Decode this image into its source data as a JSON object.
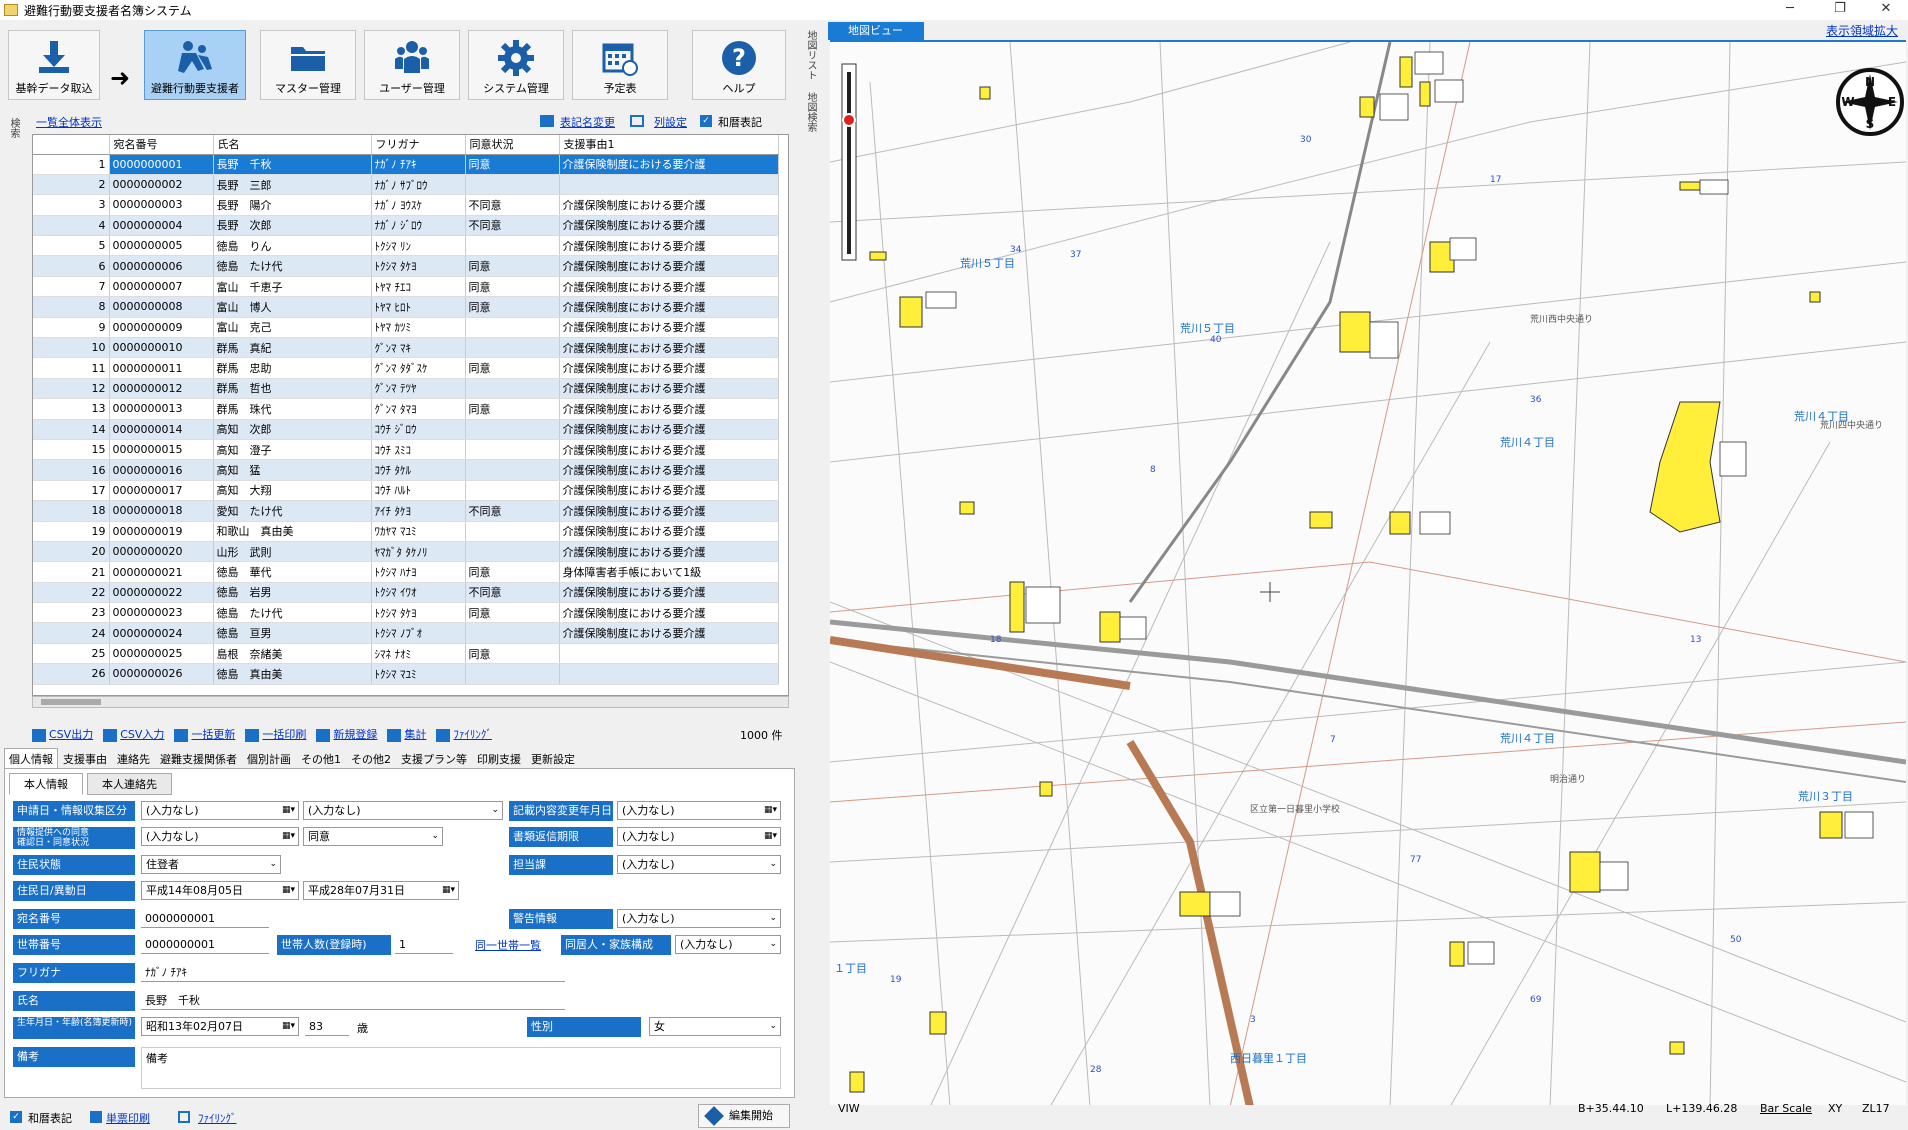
{
  "window": {
    "title": "避難行動要支援者名簿システム",
    "minimize": "─",
    "restore": "❐",
    "close": "✕"
  },
  "toolbar": {
    "buttons": [
      {
        "label": "基幹データ取込",
        "icon": "download-icon"
      },
      {
        "label": "避難行動要支援者",
        "icon": "evacuation-icon",
        "active": true
      },
      {
        "label": "マスター管理",
        "icon": "folder-icon"
      },
      {
        "label": "ユーザー管理",
        "icon": "users-icon"
      },
      {
        "label": "システム管理",
        "icon": "gear-icon"
      },
      {
        "label": "予定表",
        "icon": "calendar-icon"
      },
      {
        "label": "ヘルプ",
        "icon": "help-icon"
      }
    ],
    "arrow": "➜"
  },
  "side_left": "検索",
  "side_right": [
    "地図リスト",
    "地図検索"
  ],
  "grid_header": {
    "show_all": "一覧全体表示",
    "rename": "表記名変更",
    "col_settings": "列設定",
    "wareki": "和暦表記"
  },
  "grid": {
    "columns": [
      "宛名番号",
      "氏名",
      "フリガナ",
      "同意状況",
      "支援事由1"
    ],
    "rows": [
      [
        "1",
        "0000000001",
        "長野　千秋",
        "ﾅｶﾞﾉ ﾁｱｷ",
        "同意",
        "介護保険制度における要介護"
      ],
      [
        "2",
        "0000000002",
        "長野　三郎",
        "ﾅｶﾞﾉ ｻﾌﾞﾛｳ",
        "",
        ""
      ],
      [
        "3",
        "0000000003",
        "長野　陽介",
        "ﾅｶﾞﾉ ﾖｳｽｹ",
        "不同意",
        "介護保険制度における要介護"
      ],
      [
        "4",
        "0000000004",
        "長野　次郎",
        "ﾅｶﾞﾉ ｼﾞﾛｳ",
        "不同意",
        "介護保険制度における要介護"
      ],
      [
        "5",
        "0000000005",
        "徳島　りん",
        "ﾄｸｼﾏ ﾘﾝ",
        "",
        "介護保険制度における要介護"
      ],
      [
        "6",
        "0000000006",
        "徳島　たけ代",
        "ﾄｸｼﾏ ﾀｹﾖ",
        "同意",
        "介護保険制度における要介護"
      ],
      [
        "7",
        "0000000007",
        "富山　千恵子",
        "ﾄﾔﾏ ﾁｴｺ",
        "同意",
        "介護保険制度における要介護"
      ],
      [
        "8",
        "0000000008",
        "富山　博人",
        "ﾄﾔﾏ ﾋﾛﾄ",
        "同意",
        "介護保険制度における要介護"
      ],
      [
        "9",
        "0000000009",
        "富山　克己",
        "ﾄﾔﾏ ｶﾂﾐ",
        "",
        "介護保険制度における要介護"
      ],
      [
        "10",
        "0000000010",
        "群馬　真紀",
        "ｸﾞﾝﾏ ﾏｷ",
        "",
        "介護保険制度における要介護"
      ],
      [
        "11",
        "0000000011",
        "群馬　忠助",
        "ｸﾞﾝﾏ ﾀﾀﾞｽｹ",
        "同意",
        "介護保険制度における要介護"
      ],
      [
        "12",
        "0000000012",
        "群馬　哲也",
        "ｸﾞﾝﾏ ﾃﾂﾔ",
        "",
        "介護保険制度における要介護"
      ],
      [
        "13",
        "0000000013",
        "群馬　珠代",
        "ｸﾞﾝﾏ ﾀﾏﾖ",
        "同意",
        "介護保険制度における要介護"
      ],
      [
        "14",
        "0000000014",
        "高知　次郎",
        "ｺｳﾁ ｼﾞﾛｳ",
        "",
        "介護保険制度における要介護"
      ],
      [
        "15",
        "0000000015",
        "高知　澄子",
        "ｺｳﾁ ｽﾐｺ",
        "",
        "介護保険制度における要介護"
      ],
      [
        "16",
        "0000000016",
        "高知　猛",
        "ｺｳﾁ ﾀｹﾙ",
        "",
        "介護保険制度における要介護"
      ],
      [
        "17",
        "0000000017",
        "高知　大翔",
        "ｺｳﾁ ﾊﾙﾄ",
        "",
        "介護保険制度における要介護"
      ],
      [
        "18",
        "0000000018",
        "愛知　たけ代",
        "ｱｲﾁ ﾀｹﾖ",
        "不同意",
        "介護保険制度における要介護"
      ],
      [
        "19",
        "0000000019",
        "和歌山　真由美",
        "ﾜｶﾔﾏ ﾏﾕﾐ",
        "",
        "介護保険制度における要介護"
      ],
      [
        "20",
        "0000000020",
        "山形　武則",
        "ﾔﾏｶﾞﾀ ﾀｹﾉﾘ",
        "",
        "介護保険制度における要介護"
      ],
      [
        "21",
        "0000000021",
        "徳島　華代",
        "ﾄｸｼﾏ ﾊﾅﾖ",
        "同意",
        "身体障害者手帳において1級"
      ],
      [
        "22",
        "0000000022",
        "徳島　岩男",
        "ﾄｸｼﾏ ｲﾜｵ",
        "不同意",
        "介護保険制度における要介護"
      ],
      [
        "23",
        "0000000023",
        "徳島　たけ代",
        "ﾄｸｼﾏ ﾀｹﾖ",
        "同意",
        "介護保険制度における要介護"
      ],
      [
        "24",
        "0000000024",
        "徳島　亘男",
        "ﾄｸｼﾏ ﾉﾌﾞｵ",
        "",
        "介護保険制度における要介護"
      ],
      [
        "25",
        "0000000025",
        "島根　奈緒美",
        "ｼﾏﾈ ﾅｵﾐ",
        "同意",
        ""
      ],
      [
        "26",
        "0000000026",
        "徳島　真由美",
        "ﾄｸｼﾏ ﾏﾕﾐ",
        "",
        ""
      ]
    ]
  },
  "actions": [
    "CSV出力",
    "CSV入力",
    "一括更新",
    "一括印刷",
    "新規登録",
    "集計",
    "ﾌｧｲﾘﾝｸﾞ"
  ],
  "count": "1000 件",
  "tabs": [
    "個人情報",
    "支援事由",
    "連絡先",
    "避難支援関係者",
    "個別計画",
    "その他1",
    "その他2",
    "支援プラン等",
    "印刷支援",
    "更新設定"
  ],
  "subtabs": [
    "本人情報",
    "本人連絡先"
  ],
  "form": {
    "l_apply": "申請日・情報収集区分",
    "v_apply1": "(入力なし)",
    "v_apply2": "(入力なし)",
    "l_record": "記載内容変更年月日",
    "v_record": "(入力なし)",
    "l_consent": "情報提供への同意\n確認日・同意状況",
    "v_consent1": "(入力なし)",
    "v_consent2": "同意",
    "l_doc": "書類返信期限",
    "v_doc": "(入力なし)",
    "l_resident": "住民状態",
    "v_resident": "住登者",
    "l_charge": "担当課",
    "v_charge": "(入力なし)",
    "l_resdate": "住民日/異動日",
    "v_resdate1": "平成14年08月05日",
    "v_resdate2": "平成28年07月31日",
    "l_addr": "宛名番号",
    "v_addr": "0000000001",
    "l_warn": "警告情報",
    "v_warn": "(入力なし)",
    "l_household": "世帯番号",
    "v_household": "0000000001",
    "l_hcount": "世帯人数(登録時)",
    "v_hcount": "1",
    "household_link": "同一世帯一覧",
    "l_family": "同居人・家族構成",
    "v_family": "(入力なし)",
    "l_kana": "フリガナ",
    "v_kana": "ﾅｶﾞﾉ ﾁｱｷ",
    "l_name": "氏名",
    "v_name": "長野　千秋",
    "l_birth": "生年月日・年齢(名簿更新時)",
    "v_birth": "昭和13年02月07日",
    "v_age": "83",
    "age_unit": "歳",
    "l_sex": "性別",
    "v_sex": "女",
    "l_note": "備考",
    "v_note": "備考"
  },
  "bottom": {
    "wareki": "和暦表記",
    "print": "単票印刷",
    "filing": "ﾌｧｲﾘﾝｸﾞ",
    "edit": "編集開始"
  },
  "map": {
    "tab": "地図ビュー",
    "expand": "表示領域拡大",
    "compass": {
      "n": "N",
      "e": "E",
      "s": "S",
      "w": "W"
    },
    "labels": [
      "荒川５丁目",
      "荒川５丁目",
      "荒川４丁目",
      "荒川４丁目",
      "荒川４丁目",
      "荒川３丁目",
      "西日暮里１丁目",
      "荒川西中央通り",
      "荒川四中央通り",
      "明治通り",
      "区立第一日暮里小学校",
      "１丁目"
    ],
    "status": {
      "viw": "VIW",
      "lat": "B+35.44.10",
      "lon": "L+139.46.28",
      "scale": "Bar Scale",
      "xy": "XY",
      "zoom": "ZL17"
    }
  }
}
